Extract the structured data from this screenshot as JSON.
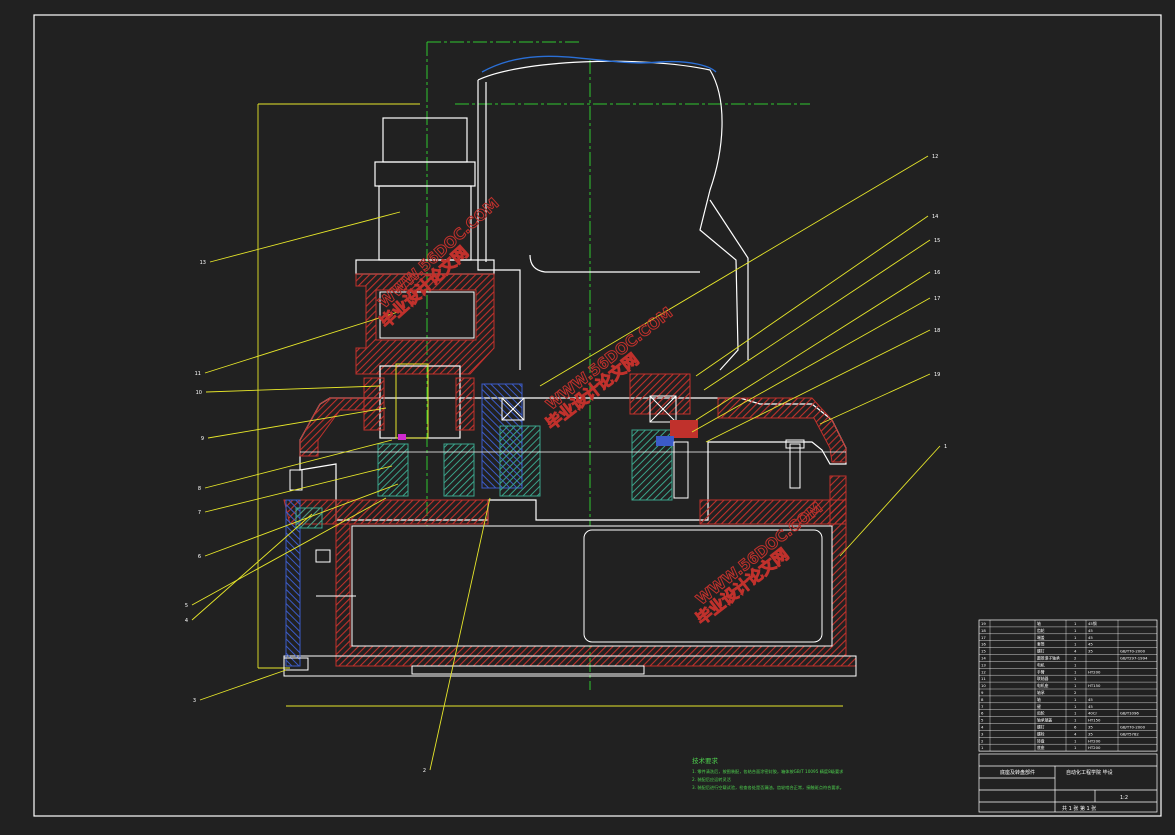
{
  "drawing": {
    "title": "",
    "colors": {
      "background": "#212121",
      "border": "#ffffff",
      "outline": "#ffffff",
      "leader": "#e6e62a",
      "center_line": "#2ec82e",
      "hatch": "#c0312c",
      "section_blue": "#3b5bc8",
      "section_green": "#3aa38a",
      "curve": "#2a6fd6",
      "watermark": "#c0312c",
      "notes_text": "#4ed14e"
    }
  },
  "callouts": [
    "13",
    "11",
    "10",
    "9",
    "8",
    "7",
    "6",
    "5",
    "4",
    "3",
    "2",
    "1",
    "12",
    "14",
    "15",
    "16",
    "17",
    "18",
    "19"
  ],
  "watermarks": [
    {
      "cn": "毕业设计论文网",
      "url": "WWW.56DOC.COM"
    },
    {
      "cn": "毕业设计论文网",
      "url": "WWW.56DOC.COM"
    },
    {
      "cn": "毕业设计论文网",
      "url": "WWW.56DOC.COM"
    }
  ],
  "notes": {
    "heading": "技术要求",
    "lines": [
      "1. 零件清洗后，按图装配，各结合面涂密封胶，箱体按GB/T 10095 精度8级要求",
      "2. 装配后应运转灵活",
      "3. 装配后进行空载试验，检查各处是否漏油，齿轮啮合正常，接触斑点符合要求。"
    ]
  },
  "title_block": {
    "drawing_name": "底座及转盘部件",
    "school": "自动化工程学院 毕设",
    "scale": "1:2",
    "sheet": "共 1 张 第 1 张"
  },
  "parts_list": [
    {
      "no": "19",
      "name": "轴",
      "qty": "1",
      "mat": "45钢",
      "note": ""
    },
    {
      "no": "18",
      "name": "齿轮",
      "qty": "1",
      "mat": "45",
      "note": ""
    },
    {
      "no": "17",
      "name": "端盖",
      "qty": "1",
      "mat": "45",
      "note": ""
    },
    {
      "no": "16",
      "name": "套筒",
      "qty": "1",
      "mat": "45",
      "note": ""
    },
    {
      "no": "15",
      "name": "螺钉",
      "qty": "4",
      "mat": "35",
      "note": "GB/T70-2000"
    },
    {
      "no": "14",
      "name": "圆锥滚子轴承",
      "qty": "2",
      "mat": "",
      "note": "GB/T297-1994"
    },
    {
      "no": "13",
      "name": "电机",
      "qty": "1",
      "mat": "",
      "note": ""
    },
    {
      "no": "12",
      "name": "手臂",
      "qty": "1",
      "mat": "HT200",
      "note": ""
    },
    {
      "no": "11",
      "name": "联轴器",
      "qty": "1",
      "mat": "",
      "note": ""
    },
    {
      "no": "10",
      "name": "电机座",
      "qty": "1",
      "mat": "HT150",
      "note": ""
    },
    {
      "no": "9",
      "name": "轴承",
      "qty": "2",
      "mat": "",
      "note": ""
    },
    {
      "no": "8",
      "name": "轴",
      "qty": "1",
      "mat": "45",
      "note": ""
    },
    {
      "no": "7",
      "name": "键",
      "qty": "1",
      "mat": "45",
      "note": ""
    },
    {
      "no": "6",
      "name": "齿轮",
      "qty": "1",
      "mat": "40Cr",
      "note": "GB/T1096"
    },
    {
      "no": "5",
      "name": "轴承端盖",
      "qty": "1",
      "mat": "HT150",
      "note": ""
    },
    {
      "no": "4",
      "name": "螺钉",
      "qty": "6",
      "mat": "35",
      "note": "GB/T70-2000"
    },
    {
      "no": "3",
      "name": "螺栓",
      "qty": "4",
      "mat": "35",
      "note": "GB/T5782"
    },
    {
      "no": "2",
      "name": "转盘",
      "qty": "1",
      "mat": "HT200",
      "note": ""
    },
    {
      "no": "1",
      "name": "底座",
      "qty": "1",
      "mat": "HT200",
      "note": ""
    }
  ]
}
